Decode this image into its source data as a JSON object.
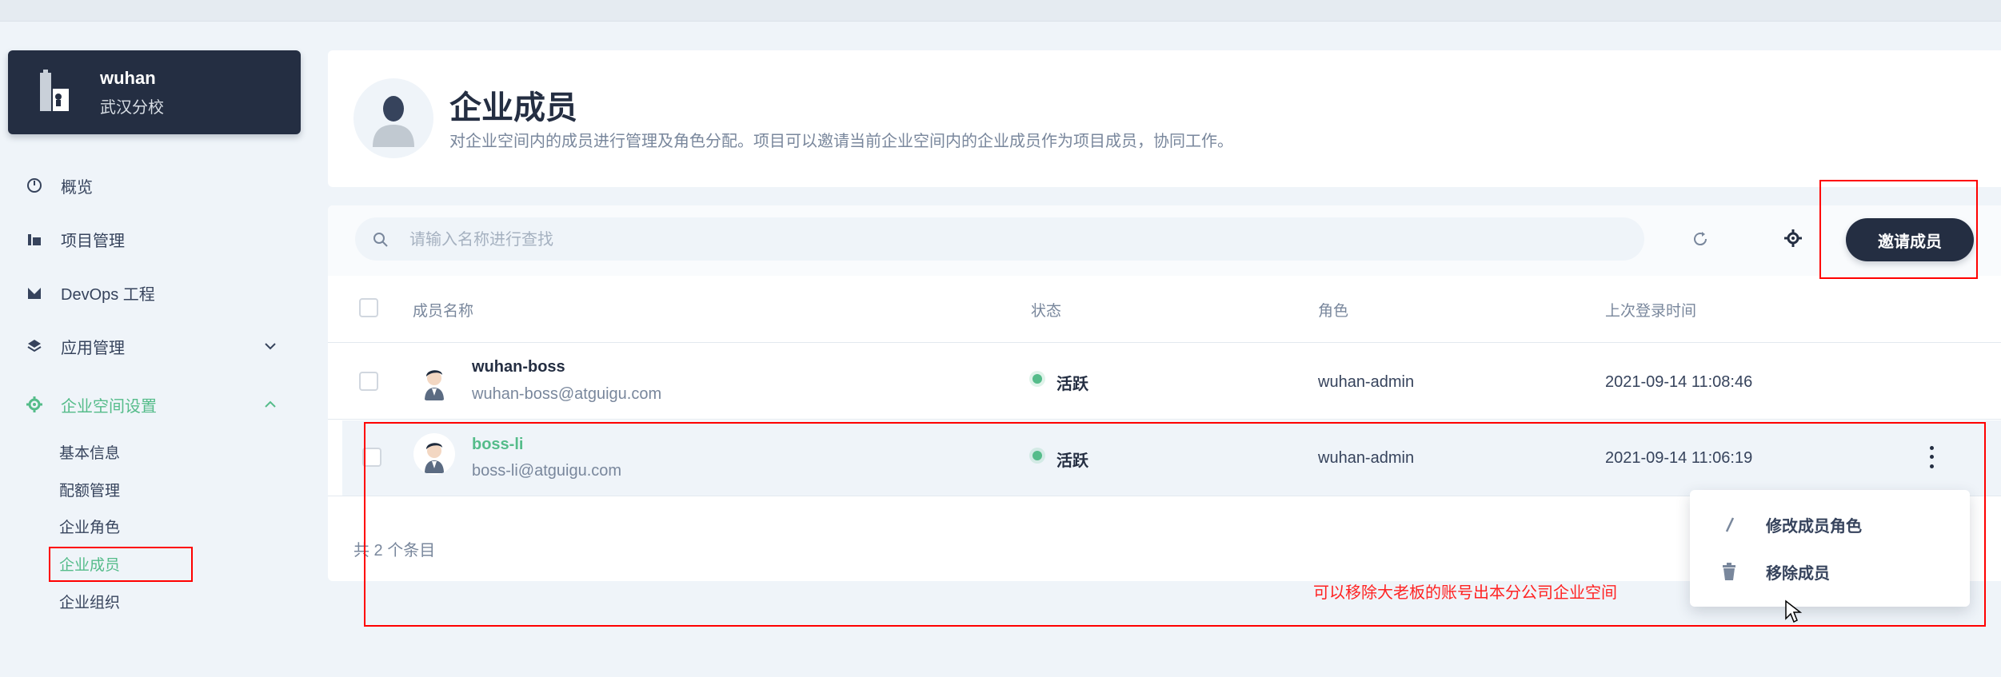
{
  "workspace": {
    "name": "wuhan",
    "subtitle": "武汉分校"
  },
  "sidebar": {
    "items": [
      {
        "label": "概览",
        "icon": "dashboard-icon"
      },
      {
        "label": "项目管理",
        "icon": "project-icon"
      },
      {
        "label": "DevOps 工程",
        "icon": "devops-icon"
      },
      {
        "label": "应用管理",
        "icon": "app-icon"
      },
      {
        "label": "企业空间设置",
        "icon": "gear-icon"
      }
    ],
    "sub_items": [
      {
        "label": "基本信息"
      },
      {
        "label": "配额管理"
      },
      {
        "label": "企业角色"
      },
      {
        "label": "企业成员"
      },
      {
        "label": "企业组织"
      }
    ]
  },
  "header": {
    "title": "企业成员",
    "description": "对企业空间内的成员进行管理及角色分配。项目可以邀请当前企业空间内的企业成员作为项目成员，协同工作。"
  },
  "toolbar": {
    "search_placeholder": "请输入名称进行查找",
    "invite_label": "邀请成员"
  },
  "table": {
    "columns": {
      "name": "成员名称",
      "status": "状态",
      "role": "角色",
      "last_login": "上次登录时间"
    },
    "rows": [
      {
        "name": "wuhan-boss",
        "email": "wuhan-boss@atguigu.com",
        "status": "活跃",
        "role": "wuhan-admin",
        "last_login": "2021-09-14 11:08:46"
      },
      {
        "name": "boss-li",
        "email": "boss-li@atguigu.com",
        "status": "活跃",
        "role": "wuhan-admin",
        "last_login": "2021-09-14 11:06:19"
      }
    ],
    "total": "共 2 个条目"
  },
  "menu": {
    "items": [
      {
        "label": "修改成员角色",
        "icon": "edit-icon"
      },
      {
        "label": "移除成员",
        "icon": "trash-icon"
      }
    ]
  },
  "annotation": {
    "text": "可以移除大老板的账号出本分公司企业空间",
    "color": "#ff0000"
  },
  "colors": {
    "accent": "#55bc8a",
    "dark": "#242e42",
    "background": "#eff4f9"
  }
}
